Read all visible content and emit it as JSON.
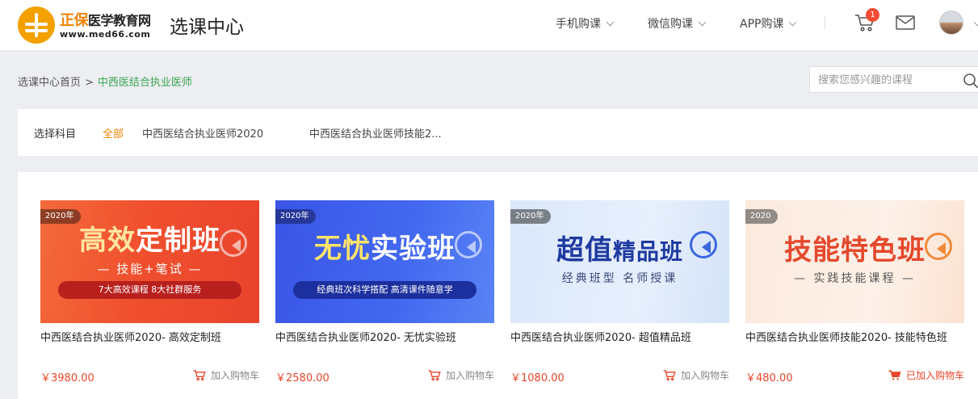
{
  "header": {
    "logo_main": "正保",
    "logo_sub": "医学教育网",
    "logo_url": "www.med66.com",
    "title": "选课中心",
    "nav": [
      {
        "label": "手机购课"
      },
      {
        "label": "微信购课"
      },
      {
        "label": "APP购课"
      }
    ],
    "cart_count": "1"
  },
  "breadcrumb": {
    "home": "选课中心首页",
    "separator": ">",
    "current": "中西医结合执业医师"
  },
  "search": {
    "placeholder": "搜索您感兴趣的课程",
    "value": ""
  },
  "filter": {
    "label": "选择科目",
    "options": [
      {
        "label": "全部",
        "active": true
      },
      {
        "label": "中西医结合执业医师2020",
        "active": false
      },
      {
        "label": "中西医结合执业医师技能2...",
        "active": false
      }
    ]
  },
  "courses": [
    {
      "year_tag": "2020年",
      "banner_title_a": "高效",
      "banner_title_b": "定制班",
      "banner_sub": "— 技能+笔试 —",
      "banner_pill": "7大高效课程  8大社群服务",
      "name": "中西医结合执业医师2020- 高效定制班",
      "price": "￥3980.00",
      "cart_label": "加入购物车",
      "in_cart": false
    },
    {
      "year_tag": "2020年",
      "banner_title_a": "无忧",
      "banner_title_b": "实验班",
      "banner_sub": "",
      "banner_pill": "经典班次科学搭配 高清课件随意学",
      "name": "中西医结合执业医师2020- 无忧实验班",
      "price": "￥2580.00",
      "cart_label": "加入购物车",
      "in_cart": false
    },
    {
      "year_tag": "2020年",
      "banner_title_a": "超值",
      "banner_title_b": "精品班",
      "banner_sub": "经典班型  名师授课",
      "banner_pill": "",
      "name": "中西医结合执业医师2020- 超值精品班",
      "price": "￥1080.00",
      "cart_label": "加入购物车",
      "in_cart": false
    },
    {
      "year_tag": "2020",
      "banner_title_a": "技能",
      "banner_title_b": "特色班",
      "banner_sub": "— 实践技能课程 —",
      "banner_pill": "",
      "name": "中西医结合执业医师技能2020- 技能特色班",
      "price": "￥480.00",
      "cart_label": "已加入购物车",
      "in_cart": true
    }
  ],
  "colors": {
    "accent_orange": "#f08200",
    "breadcrumb_green": "#3ba552",
    "price_red": "#e8462a",
    "badge_red": "#f24b35"
  }
}
